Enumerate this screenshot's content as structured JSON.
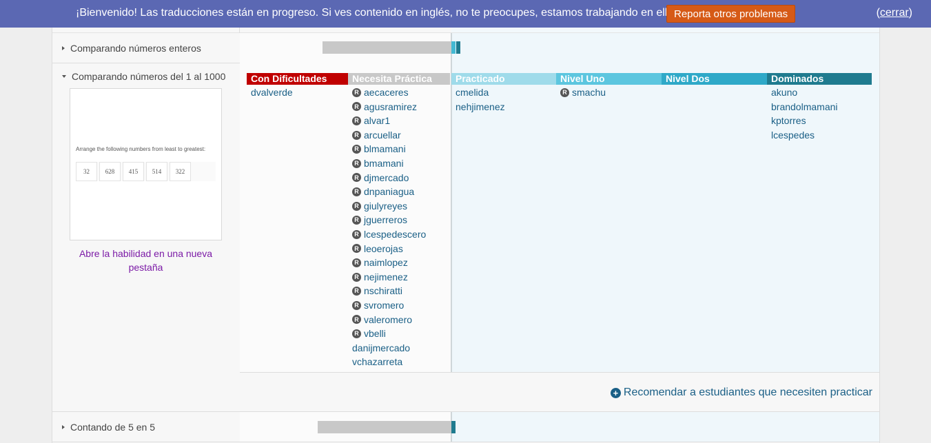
{
  "banner": {
    "message": "¡Bienvenido! Las traducciones están en progreso. Si ves contenido en inglés, no te preocupes, estamos trabajando en ello.",
    "report_button": "Reporta otros problemas",
    "close_open": "(",
    "close_link": "cerrar",
    "close_end": ")"
  },
  "skills": [
    {
      "label": "Comparando números enteros",
      "state": "collapsed"
    },
    {
      "label": "Comparando números del 1 al 1000",
      "state": "expanded"
    },
    {
      "label": "Contando de 5 en 5",
      "state": "collapsed"
    }
  ],
  "preview": {
    "instruction": "Arrange the following numbers from least to greatest:",
    "numbers": [
      "32",
      "628",
      "415",
      "514",
      "322"
    ],
    "open_link": "Abre la habilidad en una nueva pestaña"
  },
  "mastery_levels": [
    {
      "name": "Con Dificultades",
      "color": "#c00000",
      "students": [
        {
          "name": "dvalverde",
          "review": false
        }
      ]
    },
    {
      "name": "Necesita Práctica",
      "color": "#c8c8c8",
      "students": [
        {
          "name": "aecaceres",
          "review": true
        },
        {
          "name": "agusramirez",
          "review": true
        },
        {
          "name": "alvar1",
          "review": true
        },
        {
          "name": "arcuellar",
          "review": true
        },
        {
          "name": "blmamani",
          "review": true
        },
        {
          "name": "bmamani",
          "review": true
        },
        {
          "name": "djmercado",
          "review": true
        },
        {
          "name": "dnpaniagua",
          "review": true
        },
        {
          "name": "giulyreyes",
          "review": true
        },
        {
          "name": "jguerreros",
          "review": true
        },
        {
          "name": "lcespedescero",
          "review": true
        },
        {
          "name": "leoerojas",
          "review": true
        },
        {
          "name": "naimlopez",
          "review": true
        },
        {
          "name": "nejimenez",
          "review": true
        },
        {
          "name": "nschiratti",
          "review": true
        },
        {
          "name": "svromero",
          "review": true
        },
        {
          "name": "valeromero",
          "review": true
        },
        {
          "name": "vbelli",
          "review": true
        },
        {
          "name": "danijmercado",
          "review": false
        },
        {
          "name": "vchazarreta",
          "review": false
        }
      ]
    },
    {
      "name": "Practicado",
      "color": "#9fdbea",
      "students": [
        {
          "name": "cmelida",
          "review": false
        },
        {
          "name": "nehjimenez",
          "review": false
        }
      ]
    },
    {
      "name": "Nivel Uno",
      "color": "#5cc6df",
      "students": [
        {
          "name": "smachu",
          "review": true
        }
      ]
    },
    {
      "name": "Nivel Dos",
      "color": "#2fa9c8",
      "students": []
    },
    {
      "name": "Dominados",
      "color": "#1f7b8f",
      "students": [
        {
          "name": "akuno",
          "review": false
        },
        {
          "name": "brandolmamani",
          "review": false
        },
        {
          "name": "kptorres",
          "review": false
        },
        {
          "name": "lcespedes",
          "review": false
        }
      ]
    }
  ],
  "review_badge": "R",
  "recommend": {
    "icon": "plus-circle-icon",
    "label": "Recomendar a estudiantes que necesiten practicar"
  },
  "progress_bars": {
    "Comparando números enteros": {
      "needs_practice": 0.61,
      "practiced": 0.01,
      "mastered": 0.02
    },
    "Contando de 5 en 5": {
      "needs_practice": 0.63,
      "mastered": 0.02
    }
  }
}
